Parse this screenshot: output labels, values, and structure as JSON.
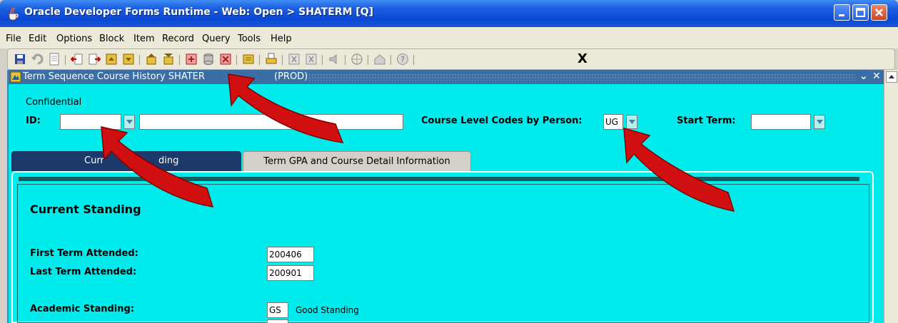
{
  "window": {
    "title": "Oracle Developer Forms Runtime - Web:  Open > SHATERM [Q]"
  },
  "menubar": {
    "items": [
      "File",
      "Edit",
      "Options",
      "Block",
      "Item",
      "Record",
      "Query",
      "Tools",
      "Help"
    ]
  },
  "toolbar": {
    "exit_label": "X"
  },
  "form": {
    "title": "Term Sequence Course History  SHATER",
    "title_suffix": "(PROD)",
    "confidential": "Confidential",
    "id_label": "ID:",
    "id_value": "",
    "name_value": "",
    "course_level_label": "Course Level Codes by Person:",
    "course_level_value": "UG",
    "start_term_label": "Start Term:",
    "start_term_value": ""
  },
  "tabs": [
    {
      "label_left": "Curr",
      "label_right": "ding",
      "active": true
    },
    {
      "label": "Term GPA and Course Detail Information",
      "active": false
    }
  ],
  "standing": {
    "heading": "Current Standing",
    "first_term_label": "First Term Attended:",
    "first_term_value": "200406",
    "last_term_label": "Last Term Attended:",
    "last_term_value": "200901",
    "academic_label": "Academic Standing:",
    "academic_code": "GS",
    "academic_desc": "Good Standing"
  },
  "colors": {
    "form_bg": "#00ecec",
    "titlebar": "#0a48d4",
    "arrow": "#d01010"
  }
}
